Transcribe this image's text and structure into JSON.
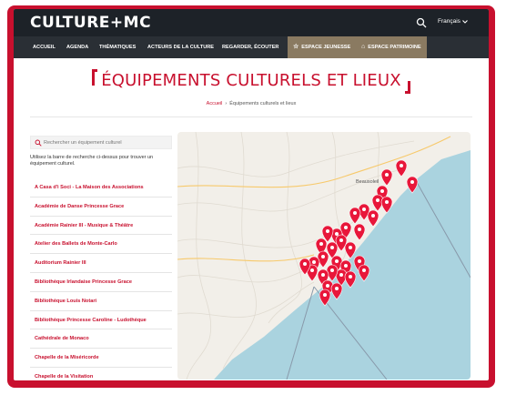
{
  "header": {
    "logo": "CULTURE+MC",
    "language": "Français",
    "search_icon": "search-icon",
    "chevron_icon": "chevron-down-icon"
  },
  "nav": {
    "items": [
      {
        "label": "ACCUEIL"
      },
      {
        "label": "AGENDA"
      },
      {
        "label": "THÉMATIQUES"
      },
      {
        "label": "ACTEURS DE LA CULTURE"
      },
      {
        "label": "REGARDER, ÉCOUTER"
      },
      {
        "label": "ESPACE JEUNESSE",
        "icon": "star-icon"
      },
      {
        "label": "ESPACE PATRIMOINE",
        "icon": "monument-icon"
      }
    ],
    "special_color": "#8a7a61"
  },
  "page": {
    "title": "ÉQUIPEMENTS CULTURELS ET LIEUX",
    "breadcrumb": {
      "home": "Accueil",
      "current": "Équipements culturels et lieux"
    }
  },
  "search": {
    "placeholder": "Rechercher un équipement culturel",
    "helper": "Utilisez la barre de recherche ci-dessus pour trouver un équipement culturel."
  },
  "list": [
    "A Casa d'i Soci - La Maison des Associations",
    "Académie de Danse Princesse Grace",
    "Académie Rainier III - Musique & Théâtre",
    "Atelier des Ballets de Monte-Carlo",
    "Auditorium Rainier III",
    "Bibliothèque Irlandaise Princesse Grace",
    "Bibliothèque Louis Notari",
    "Bibliothèque Princesse Caroline - Ludothèque",
    "Cathédrale de Monaco",
    "Chapelle de la Miséricorde",
    "Chapelle de la Visitation"
  ],
  "map": {
    "place_label": "Beausoleil",
    "marker_color": "#e8173a",
    "sea_color": "#aad3df"
  },
  "colors": {
    "accent": "#c8102e",
    "header_bg": "#1d2228",
    "nav_bg": "#2a2f35"
  }
}
